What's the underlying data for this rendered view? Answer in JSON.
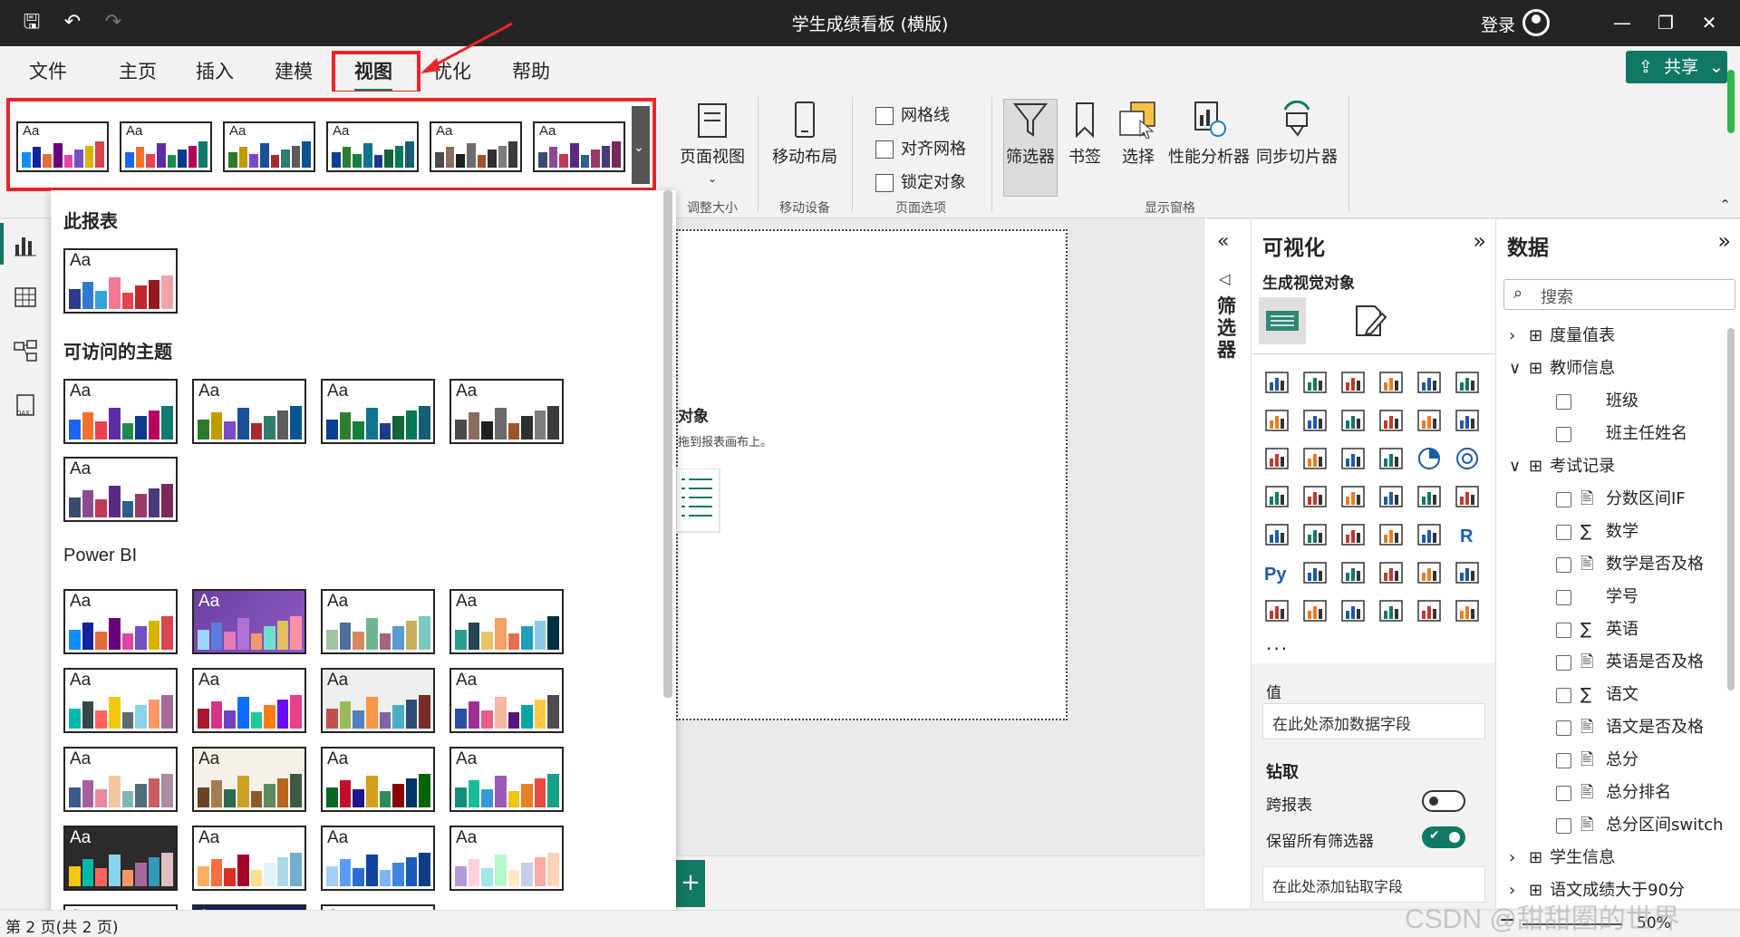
{
  "window": {
    "title": "学生成绩看板 (横版)",
    "login_label": "登录"
  },
  "menu": {
    "tabs": [
      "文件",
      "主页",
      "插入",
      "建模",
      "视图",
      "优化",
      "帮助"
    ],
    "active_tab": "视图",
    "share_label": "共享"
  },
  "ribbon": {
    "page_view_label": "页面视图",
    "mobile_layout_label": "移动布局",
    "checkboxes": [
      "网格线",
      "对齐网格",
      "锁定对象"
    ],
    "pane_buttons": [
      "筛选器",
      "书签",
      "选择",
      "性能分析器",
      "同步切片器"
    ],
    "groups": [
      "调整大小",
      "移动设备",
      "页面选项",
      "显示窗格"
    ]
  },
  "theme_panel": {
    "section_this_report": "此报表",
    "section_accessible": "可访问的主题",
    "section_powerbi": "Power BI",
    "aa": "Aa"
  },
  "canvas": {
    "partial_heading": "对象",
    "partial_hint": "拖到报表画布上。"
  },
  "filters_pane": {
    "label": "筛选器"
  },
  "viz_pane": {
    "title": "可视化",
    "subtitle": "生成视觉对象",
    "more": "...",
    "values_label": "值",
    "values_placeholder": "在此处添加数据字段",
    "drill_label": "钻取",
    "cross_report_label": "跨报表",
    "keep_filters_label": "保留所有筛选器",
    "drill_placeholder": "在此处添加钻取字段"
  },
  "data_pane": {
    "title": "数据",
    "search_placeholder": "搜索",
    "tables": [
      {
        "name": "度量值表",
        "expanded": false
      },
      {
        "name": "教师信息",
        "expanded": true,
        "fields": [
          "班级",
          "班主任姓名"
        ]
      },
      {
        "name": "考试记录",
        "expanded": true,
        "fields": [
          "分数区间IF",
          "数学",
          "数学是否及格",
          "学号",
          "英语",
          "英语是否及格",
          "语文",
          "语文是否及格",
          "总分",
          "总分排名",
          "总分区间switch"
        ]
      },
      {
        "name": "学生信息",
        "expanded": false
      },
      {
        "name": "语文成绩大于90分",
        "expanded": false
      }
    ]
  },
  "status": {
    "page_label": "第 2 页(共 2 页)",
    "zoom": "50%",
    "watermark": "CSDN @甜甜圈的世界"
  },
  "colors": {
    "titlebar": "#252423",
    "accent": "#117865",
    "annotation_red": "#e8262a"
  }
}
